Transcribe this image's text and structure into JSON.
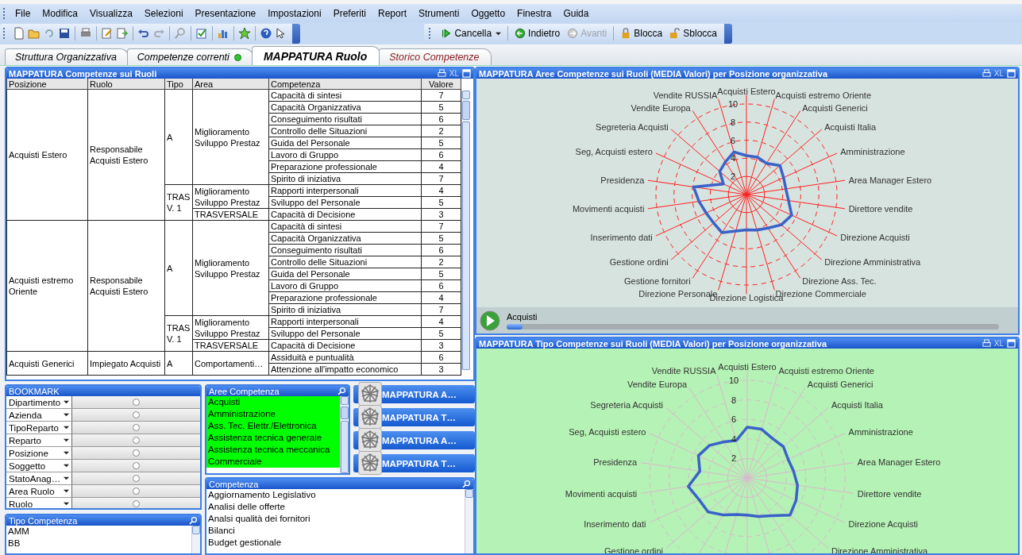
{
  "menu": [
    "File",
    "Modifica",
    "Visualizza",
    "Selezioni",
    "Presentazione",
    "Impostazioni",
    "Preferiti",
    "Report",
    "Strumenti",
    "Oggetto",
    "Finestra",
    "Guida"
  ],
  "toolbar_right": [
    {
      "label": "Cancella",
      "kind": "dropdown",
      "disabled": false
    },
    {
      "label": "Indietro",
      "kind": "button",
      "disabled": false
    },
    {
      "label": "Avanti",
      "kind": "button",
      "disabled": true
    },
    {
      "label": "Blocca",
      "kind": "button",
      "disabled": false
    },
    {
      "label": "Sblocca",
      "kind": "button",
      "disabled": false
    }
  ],
  "tabs": [
    {
      "label": "Struttura Organizzativa",
      "selected": false,
      "dot": false,
      "color": "#000000"
    },
    {
      "label": "Competenze correnti",
      "selected": false,
      "dot": true,
      "color": "#000000"
    },
    {
      "label": "MAPPATURA Ruolo",
      "selected": true,
      "dot": false,
      "color": "#000000"
    },
    {
      "label": "Storico Competenze",
      "selected": false,
      "dot": false,
      "color": "#8b1a1a"
    }
  ],
  "table": {
    "title": "MAPPATURA Competenze sui Ruoli",
    "xl": "XL",
    "columns": [
      "Posizione",
      "Ruolo",
      "Tipo",
      "Area",
      "Competenza",
      "Valore"
    ],
    "rows": [
      {
        "posizione": "Acquisti Estero",
        "ruolo": "Responsabile Acquisti Estero",
        "tipi": [
          {
            "tipo": "A",
            "aree": [
              {
                "area": "Miglioramento Sviluppo Prestaz",
                "competenze": [
                  {
                    "nome": "Capacità di sintesi",
                    "valore": "7"
                  },
                  {
                    "nome": "Capacità Organizzativa",
                    "valore": "5"
                  },
                  {
                    "nome": "Conseguimento risultati",
                    "valore": "6"
                  },
                  {
                    "nome": "Controllo delle Situazioni",
                    "valore": "2"
                  },
                  {
                    "nome": "Guida del Personale",
                    "valore": "5"
                  },
                  {
                    "nome": "Lavoro di Gruppo",
                    "valore": "6"
                  },
                  {
                    "nome": "Preparazione professionale",
                    "valore": "4"
                  },
                  {
                    "nome": "Spirito di iniziativa",
                    "valore": "7"
                  }
                ]
              }
            ]
          },
          {
            "tipo": "TRAS V. 1",
            "aree": [
              {
                "area": "Miglioramento Sviluppo Prestaz",
                "competenze": [
                  {
                    "nome": "Rapporti interpersonali",
                    "valore": "4"
                  },
                  {
                    "nome": "Sviluppo del Personale",
                    "valore": "5"
                  }
                ]
              },
              {
                "area": "TRASVERSALE",
                "competenze": [
                  {
                    "nome": "Capacità di Decisione",
                    "valore": "3"
                  }
                ]
              }
            ]
          }
        ]
      },
      {
        "posizione": "Acquisti estremo Oriente",
        "ruolo": "Responsabile Acquisti Estero",
        "tipi": [
          {
            "tipo": "A",
            "aree": [
              {
                "area": "Miglioramento Sviluppo Prestaz",
                "competenze": [
                  {
                    "nome": "Capacità di sintesi",
                    "valore": "7"
                  },
                  {
                    "nome": "Capacità Organizzativa",
                    "valore": "5"
                  },
                  {
                    "nome": "Conseguimento risultati",
                    "valore": "6"
                  },
                  {
                    "nome": "Controllo delle Situazioni",
                    "valore": "2"
                  },
                  {
                    "nome": "Guida del Personale",
                    "valore": "5"
                  },
                  {
                    "nome": "Lavoro di Gruppo",
                    "valore": "6"
                  },
                  {
                    "nome": "Preparazione professionale",
                    "valore": "4"
                  },
                  {
                    "nome": "Spirito di iniziativa",
                    "valore": "7"
                  }
                ]
              }
            ]
          },
          {
            "tipo": "TRAS V. 1",
            "aree": [
              {
                "area": "Miglioramento Sviluppo Prestaz",
                "competenze": [
                  {
                    "nome": "Rapporti interpersonali",
                    "valore": "4"
                  },
                  {
                    "nome": "Sviluppo del Personale",
                    "valore": "5"
                  }
                ]
              },
              {
                "area": "TRASVERSALE",
                "competenze": [
                  {
                    "nome": "Capacità di Decisione",
                    "valore": "3"
                  }
                ]
              }
            ]
          }
        ]
      },
      {
        "posizione": "Acquisti Generici",
        "ruolo": "Impiegato Acquisti",
        "tipi": [
          {
            "tipo": "A",
            "aree": [
              {
                "area": "Comportamenti…",
                "competenze": [
                  {
                    "nome": "Assiduità e puntualità",
                    "valore": "6"
                  },
                  {
                    "nome": "Attenzione all'impatto economico",
                    "valore": "3"
                  }
                ]
              }
            ]
          }
        ]
      }
    ]
  },
  "chart_panels": [
    {
      "title": "MAPPATURA Aree Competenze sui Ruoli (MEDIA Valori) per Posizione organizzativa",
      "xl": "XL",
      "axis_labels_right": [
        "Acquisti Estero",
        "Acquisti estremo Oriente",
        "Acquisti Generici",
        "Acquisti Italia",
        "Amministrazione",
        "Area Manager Estero",
        "Direttore vendite",
        "Direzione Acquisti",
        "Direzione Amministrativa",
        "Direzione Ass. Tec.",
        "Direzione Commerciale",
        "Direzione Logistica"
      ],
      "axis_labels_left": [
        "Vendite RUSSIA",
        "Vendite Europa",
        "Segreteria Acquisti",
        "Seg, Acquisti estero",
        "Presidenza",
        "Movimenti acquisti",
        "Inserimento dati",
        "Gestione ordini",
        "Gestione fornitori",
        "Direzione Personale"
      ],
      "tick_labels": [
        "10",
        "8",
        "6",
        "4",
        "2"
      ],
      "player": {
        "label": "Acquisti",
        "level": 0.02
      }
    },
    {
      "title": "MAPPATURA Tipo Competenze sui Ruoli (MEDIA Valori) per Posizione organizzativa",
      "xl": "XL",
      "axis_labels_right": [
        "Acquisti Estero",
        "Acquisti estremo Oriente",
        "Acquisti Generici",
        "Acquisti Italia",
        "Amministrazione",
        "Area Manager Estero",
        "Direttore vendite",
        "Direzione Acquisti",
        "Direzione Amministrativa"
      ],
      "axis_labels_left": [
        "Vendite RUSSIA",
        "Vendite Europa",
        "Segreteria Acquisti",
        "Seg, Acquisti estero",
        "Presidenza",
        "Movimenti acquisti",
        "Inserimento dati",
        "Gestione ordini"
      ],
      "tick_labels": [
        "10",
        "8",
        "6",
        "4",
        "2"
      ]
    }
  ],
  "bookmark": {
    "title": "BOOKMARK",
    "fields": [
      {
        "label": "Dipartimento",
        "selected": false
      },
      {
        "label": "Azienda",
        "selected": false
      },
      {
        "label": "TipoReparto",
        "selected": false
      },
      {
        "label": "Reparto",
        "selected": false
      },
      {
        "label": "Posizione",
        "selected": false
      },
      {
        "label": "Soggetto",
        "selected": false
      },
      {
        "label": "StatoAnag…",
        "selected": false
      },
      {
        "label": "Area Ruolo",
        "selected": false
      },
      {
        "label": "Ruolo",
        "selected": false
      }
    ]
  },
  "aree_competenza": {
    "title": "Aree Competenza",
    "items": [
      {
        "label": "Acquisti",
        "selected": true
      },
      {
        "label": "Amministrazione",
        "selected": true
      },
      {
        "label": "Ass. Tec. Elettr./Elettronica",
        "selected": true
      },
      {
        "label": "Assistenza tecnica generale",
        "selected": true
      },
      {
        "label": "Assistenza tecnica meccanica",
        "selected": true
      },
      {
        "label": "Commerciale",
        "selected": true
      }
    ]
  },
  "buttons": [
    "MAPPATURA A…",
    "MAPPATURA T…",
    "MAPPATURA A…",
    "MAPPATURA T…"
  ],
  "competenza": {
    "title": "Competenza",
    "items": [
      "Aggiornamento Legislativo",
      "Analisi delle offerte",
      "Analsi qualità dei fornitori",
      "Bilanci",
      "Budget gestionale"
    ]
  },
  "tipo_competenza": {
    "title": "Tipo Competenza",
    "items": [
      "AMM",
      "BB"
    ]
  }
}
